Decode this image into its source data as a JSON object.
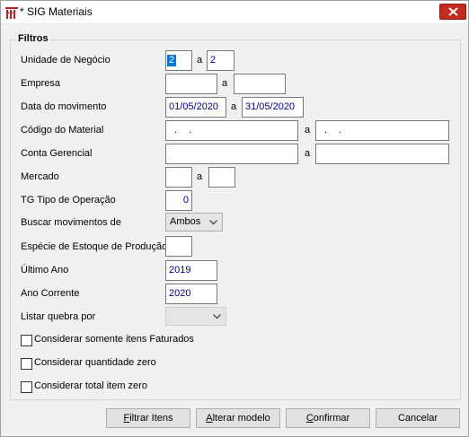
{
  "window": {
    "title": "* SIG Materiais",
    "icon": "app-logo-icon"
  },
  "filters": {
    "title": "Filtros",
    "separator": "a",
    "unidade": {
      "label": "Unidade de Negócio",
      "from": "2",
      "to": "2"
    },
    "empresa": {
      "label": "Empresa",
      "from": "",
      "to": ""
    },
    "data_movimento": {
      "label": "Data do movimento",
      "from": "01/05/2020",
      "to": "31/05/2020"
    },
    "codigo_material": {
      "label": "Código do Material",
      "from": ". .",
      "to": ". ."
    },
    "conta_gerencial": {
      "label": "Conta Gerencial",
      "from": "",
      "to": ""
    },
    "mercado": {
      "label": "Mercado",
      "from": "",
      "to": ""
    },
    "tg_tipo_operacao": {
      "label": "TG Tipo de Operação",
      "value": "0"
    },
    "buscar_movimentos": {
      "label": "Buscar movimentos de",
      "selected": "Ambos"
    },
    "especie_estoque": {
      "label": "Espécie de Estoque de Produção",
      "value": ""
    },
    "ultimo_ano": {
      "label": "Último Ano",
      "value": "2019"
    },
    "ano_corrente": {
      "label": "Ano Corrente",
      "value": "2020"
    },
    "listar_quebra": {
      "label": "Listar quebra por",
      "selected": ""
    },
    "checkboxes": [
      {
        "label": "Considerar somente itens Faturados",
        "checked": false
      },
      {
        "label": "Considerar quantidade zero",
        "checked": false
      },
      {
        "label": "Considerar total item zero",
        "checked": false
      }
    ]
  },
  "buttons": {
    "filtrar": {
      "first": "F",
      "rest": "iltrar Itens"
    },
    "alterar": {
      "first": "A",
      "rest": "lterar modelo"
    },
    "confirmar": {
      "first": "C",
      "rest": "onfirmar"
    },
    "cancelar": {
      "first": "",
      "rest": "Cancelar"
    }
  },
  "colors": {
    "value_text": "#000080",
    "close_button": "#c42b1c",
    "selection": "#0078d7"
  }
}
